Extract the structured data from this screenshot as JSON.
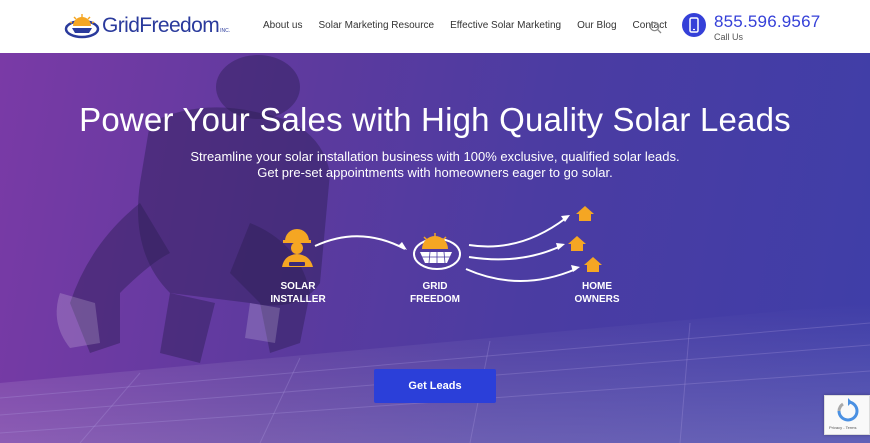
{
  "header": {
    "logo_text": "GridFreedom",
    "logo_suffix": "INC.",
    "nav": [
      "About us",
      "Solar Marketing Resource",
      "Effective Solar Marketing",
      "Our Blog",
      "Contact"
    ],
    "phone_number": "855.596.9567",
    "phone_label": "Call Us"
  },
  "hero": {
    "title": "Power Your Sales with High Quality Solar Leads",
    "subtitle_line1": "Streamline your solar installation business with 100% exclusive, qualified solar leads.",
    "subtitle_line2": "Get pre-set appointments with homeowners eager to go solar.",
    "flow": {
      "installer": [
        "SOLAR",
        "INSTALLER"
      ],
      "grid": [
        "GRID",
        "FREEDOM"
      ],
      "owners": [
        "HOME",
        "OWNERS"
      ]
    },
    "cta_label": "Get Leads"
  },
  "recaptcha": {
    "text": "Privacy - Terms"
  },
  "colors": {
    "brand": "#3540d8",
    "accent": "#f5a623",
    "nav_text": "#333333"
  }
}
